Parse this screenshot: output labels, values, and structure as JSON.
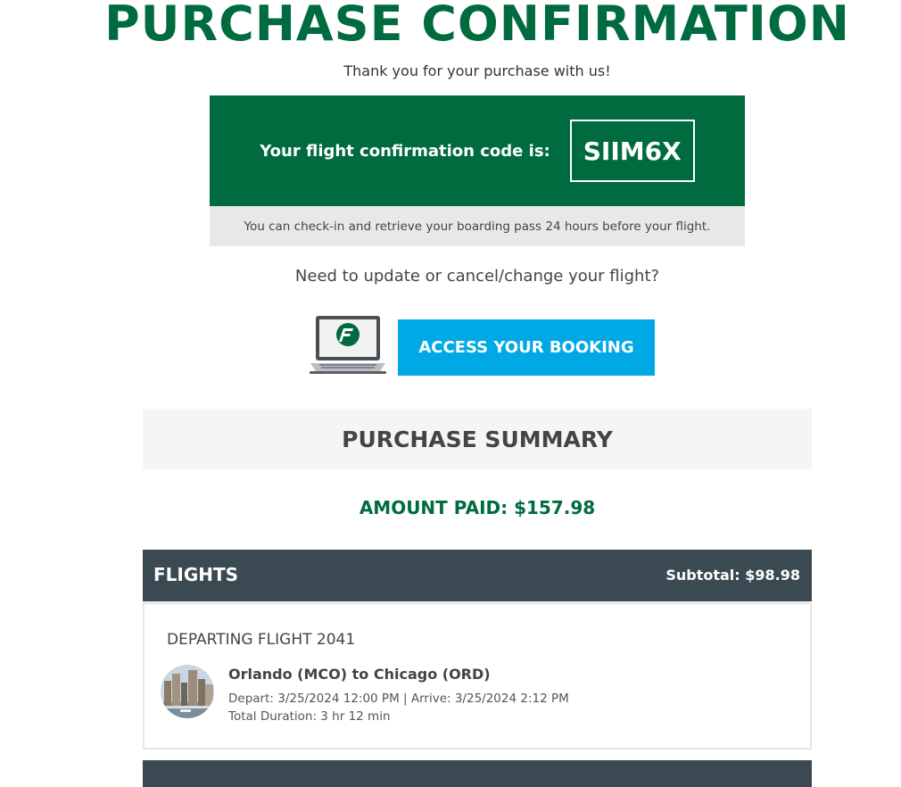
{
  "page": {
    "title": "PURCHASE CONFIRMATION",
    "thanks": "Thank you for your purchase with us!"
  },
  "confirmation": {
    "label": "Your flight confirmation code is:",
    "code": "SIIM6X",
    "checkin_note": "You can check-in and retrieve your boarding pass 24 hours before your flight."
  },
  "manage": {
    "question": "Need to update or cancel/change your flight?",
    "button_label": "ACCESS YOUR BOOKING",
    "icon": "laptop-logo-icon"
  },
  "summary": {
    "header": "PURCHASE SUMMARY",
    "amount_paid": "AMOUNT PAID: $157.98"
  },
  "flights": {
    "title": "FLIGHTS",
    "subtotal": "Subtotal: $98.98",
    "items": [
      {
        "heading": "DEPARTING FLIGHT 2041",
        "route": "Orlando (MCO) to Chicago (ORD)",
        "times": "Depart: 3/25/2024 12:00 PM | Arrive: 3/25/2024 2:12 PM",
        "duration": "Total Duration: 3 hr 12 min",
        "image": "chicago-city-photo"
      }
    ]
  },
  "colors": {
    "brand_green": "#006b3f",
    "accent_blue": "#00a9e6",
    "dark_bar": "#3b4a52"
  }
}
